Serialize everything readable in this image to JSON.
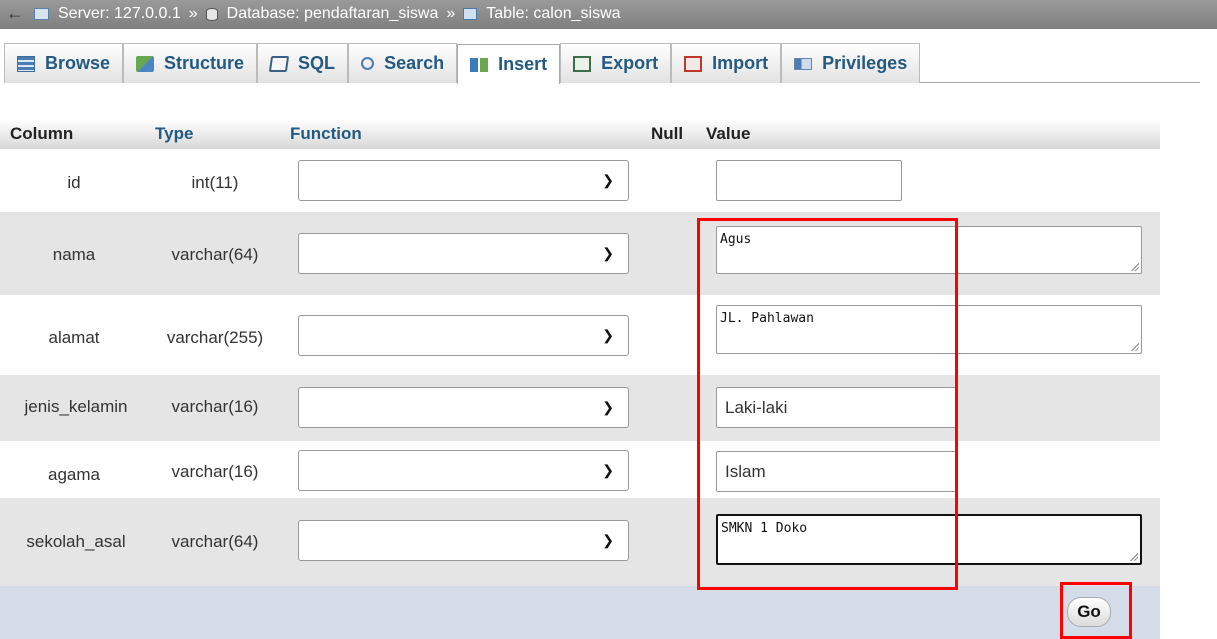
{
  "breadcrumb": {
    "back": "←",
    "server": "Server: 127.0.0.1",
    "database": "Database: pendaftaran_siswa",
    "table": "Table: calon_siswa",
    "separator": "»"
  },
  "tabs": [
    {
      "label": "Browse",
      "icon": "browse-icon"
    },
    {
      "label": "Structure",
      "icon": "structure-icon"
    },
    {
      "label": "SQL",
      "icon": "sql-icon"
    },
    {
      "label": "Search",
      "icon": "search-icon"
    },
    {
      "label": "Insert",
      "icon": "insert-icon",
      "active": true
    },
    {
      "label": "Export",
      "icon": "export-icon"
    },
    {
      "label": "Import",
      "icon": "import-icon"
    },
    {
      "label": "Privileges",
      "icon": "privileges-icon"
    }
  ],
  "headers": {
    "column": "Column",
    "type": "Type",
    "function": "Function",
    "null": "Null",
    "value": "Value"
  },
  "rows": [
    {
      "column": "id",
      "type": "int(11)",
      "value": ""
    },
    {
      "column": "nama",
      "type": "varchar(64)",
      "value": "Agus"
    },
    {
      "column": "alamat",
      "type": "varchar(255)",
      "value": "JL. Pahlawan"
    },
    {
      "column": "jenis_kelamin",
      "type": "varchar(16)",
      "value": "Laki-laki"
    },
    {
      "column": "agama",
      "type": "varchar(16)",
      "value": "Islam"
    },
    {
      "column": "sekolah_asal",
      "type": "varchar(64)",
      "value": "SMKN 1 Doko"
    }
  ],
  "go_label": "Go",
  "colors": {
    "highlight": "#ff0000",
    "link": "#235a81",
    "footer": "#d4dde7"
  }
}
